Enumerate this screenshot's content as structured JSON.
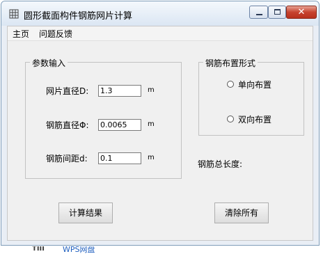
{
  "window": {
    "title": "圆形截面构件钢筋网片计算",
    "close_glyph": "✕"
  },
  "menu": {
    "items": [
      "主页",
      "问题反馈"
    ]
  },
  "params": {
    "group_title": "参数输入",
    "mesh_diameter": {
      "label": "网片直径D:",
      "value": "1.3",
      "unit": "m"
    },
    "bar_diameter": {
      "label": "钢筋直径Φ:",
      "value": "0.0065",
      "unit": "m"
    },
    "bar_spacing": {
      "label": "钢筋间距d:",
      "value": "0.1",
      "unit": "m"
    }
  },
  "layout_form": {
    "group_title": "钢筋布置形式",
    "option_single": "单向布置",
    "option_double": "双向布置",
    "selected": null
  },
  "total_length_label": "钢筋总长度:",
  "buttons": {
    "calculate": "计算结果",
    "clear": "清除所有"
  },
  "taskbar": {
    "item_text": "WPS网盘",
    "icon_text": "TIII"
  }
}
